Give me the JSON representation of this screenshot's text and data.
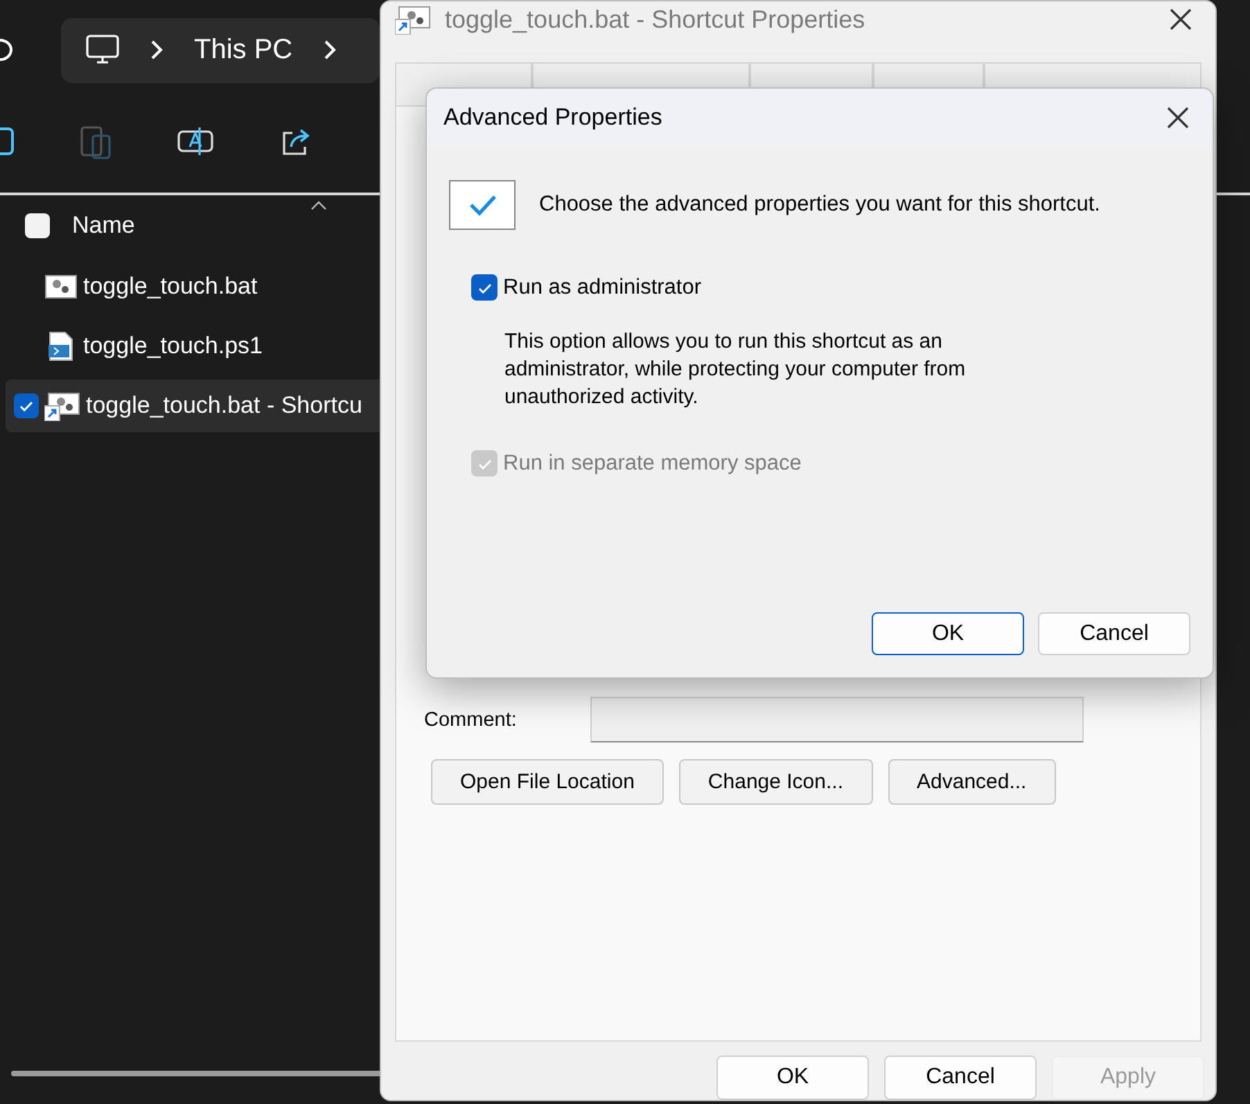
{
  "explorer": {
    "address_bar": {
      "location": "This PC"
    },
    "file_list": {
      "header": {
        "label": "Name",
        "checked": false
      },
      "rows": [
        {
          "name": "toggle_touch.bat",
          "kind": "bat",
          "selected": false
        },
        {
          "name": "toggle_touch.ps1",
          "kind": "ps1",
          "selected": false
        },
        {
          "name": "toggle_touch.bat - Shortcu",
          "kind": "shortcut",
          "selected": true
        }
      ]
    }
  },
  "properties_window": {
    "title": "toggle_touch.bat - Shortcut Properties",
    "active": false,
    "comment": {
      "label": "Comment:"
    },
    "actions": [
      {
        "label": "Open File Location"
      },
      {
        "label": "Change Icon..."
      },
      {
        "label": "Advanced..."
      }
    ],
    "footer_buttons": [
      {
        "label": "OK",
        "disabled": false
      },
      {
        "label": "Cancel",
        "disabled": false
      },
      {
        "label": "Apply",
        "disabled": true
      }
    ]
  },
  "advanced_dialog": {
    "title": "Advanced Properties",
    "intro": "Choose the advanced properties you want for this shortcut.",
    "options": [
      {
        "label": "Run as administrator",
        "checked": true,
        "disabled": false,
        "description": "This option allows you to run this shortcut as an administrator, while protecting your computer from unauthorized activity."
      },
      {
        "label": "Run in separate memory space",
        "checked": true,
        "disabled": true
      }
    ],
    "buttons": [
      {
        "label": "OK",
        "default": true
      },
      {
        "label": "Cancel",
        "default": false
      }
    ]
  }
}
